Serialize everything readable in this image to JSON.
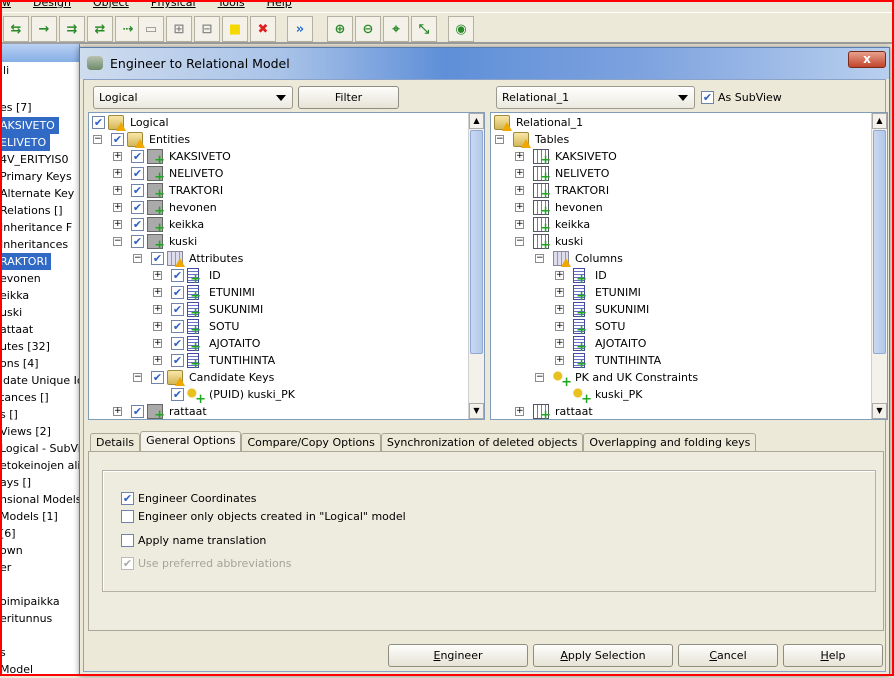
{
  "menubar": [
    "w",
    "Design",
    "Object",
    "Physical",
    "Tools",
    "Help"
  ],
  "toolbar": {
    "icons": [
      "relation-1n-icon",
      "relation-11-icon",
      "relation-1n-identifying-icon",
      "relation-nn-icon",
      "arrow-dotted-icon",
      "table-gray-icon",
      "table-add-gray-icon",
      "table-remove-gray-icon",
      "note-icon",
      "delete-icon",
      "engineer-icon",
      "zoom-in-icon",
      "zoom-out-icon",
      "fit-screen-icon",
      "resize-icon",
      "find-icon"
    ]
  },
  "left_panel": {
    "items": [
      {
        "label": "lli",
        "sel": false
      },
      {
        "label": "es [7]",
        "sel": false
      },
      {
        "label": "AKSIVETO",
        "sel": true
      },
      {
        "label": "ELIVETO",
        "sel": true
      },
      {
        "label": "4V_ERITYIS0",
        "sel": false
      },
      {
        "label": "Primary Keys",
        "sel": false
      },
      {
        "label": "Alternate Key",
        "sel": false
      },
      {
        "label": "Relations []",
        "sel": false
      },
      {
        "label": "Inheritance F",
        "sel": false
      },
      {
        "label": "Inheritances",
        "sel": false
      },
      {
        "label": "RAKTORI",
        "sel": true
      },
      {
        "label": "evonen",
        "sel": false
      },
      {
        "label": "eikka",
        "sel": false
      },
      {
        "label": "uski",
        "sel": false
      },
      {
        "label": "attaat",
        "sel": false
      },
      {
        "label": "utes [32]",
        "sel": false
      },
      {
        "label": "ons [4]",
        "sel": false
      },
      {
        "label": "idate Unique Ide",
        "sel": false
      },
      {
        "label": "tances []",
        "sel": false
      },
      {
        "label": "s []",
        "sel": false
      },
      {
        "label": "Views [2]",
        "sel": false
      },
      {
        "label": "Logical - SubVie",
        "sel": false
      },
      {
        "label": "etokeinojen alika",
        "sel": false
      },
      {
        "label": "ays []",
        "sel": false
      },
      {
        "label": "nsional Models [",
        "sel": false
      },
      {
        "label": " Models [1]",
        "sel": false
      },
      {
        "label": "[6]",
        "sel": false
      },
      {
        "label": "own",
        "sel": false
      },
      {
        "label": "er",
        "sel": false
      },
      {
        "label": "",
        "sel": false
      },
      {
        "label": "oimipaikka",
        "sel": false
      },
      {
        "label": "eritunnus",
        "sel": false
      },
      {
        "label": "",
        "sel": false
      },
      {
        "label": "s",
        "sel": false
      },
      {
        "label": "Model",
        "sel": false
      }
    ]
  },
  "dialog": {
    "title": "Engineer to Relational Model",
    "close": "x",
    "left": {
      "combo": "Logical",
      "filter": "Filter",
      "tree": [
        {
          "label": "Logical",
          "level": 0,
          "exp": "",
          "checked": true,
          "icon": "folder"
        },
        {
          "label": "Entities",
          "level": 1,
          "exp": "-",
          "checked": true,
          "icon": "folder"
        },
        {
          "label": "KAKSIVETO",
          "level": 2,
          "exp": "+",
          "checked": true,
          "icon": "entity"
        },
        {
          "label": "NELIVETO",
          "level": 2,
          "exp": "+",
          "checked": true,
          "icon": "entity"
        },
        {
          "label": "TRAKTORI",
          "level": 2,
          "exp": "+",
          "checked": true,
          "icon": "entity"
        },
        {
          "label": "hevonen",
          "level": 2,
          "exp": "+",
          "checked": true,
          "icon": "entity"
        },
        {
          "label": "keikka",
          "level": 2,
          "exp": "+",
          "checked": true,
          "icon": "entity"
        },
        {
          "label": "kuski",
          "level": 2,
          "exp": "-",
          "checked": true,
          "icon": "entity"
        },
        {
          "label": "Attributes",
          "level": 3,
          "exp": "-",
          "checked": true,
          "icon": "cols"
        },
        {
          "label": "ID",
          "level": 4,
          "exp": "+",
          "checked": true,
          "icon": "attr"
        },
        {
          "label": "ETUNIMI",
          "level": 4,
          "exp": "+",
          "checked": true,
          "icon": "attr"
        },
        {
          "label": "SUKUNIMI",
          "level": 4,
          "exp": "+",
          "checked": true,
          "icon": "attr"
        },
        {
          "label": "SOTU",
          "level": 4,
          "exp": "+",
          "checked": true,
          "icon": "attr"
        },
        {
          "label": "AJOTAITO",
          "level": 4,
          "exp": "+",
          "checked": true,
          "icon": "attr"
        },
        {
          "label": "TUNTIHINTA",
          "level": 4,
          "exp": "+",
          "checked": true,
          "icon": "attr"
        },
        {
          "label": "Candidate Keys",
          "level": 3,
          "exp": "-",
          "checked": true,
          "icon": "folder"
        },
        {
          "label": "(PUID) kuski_PK",
          "level": 4,
          "exp": "",
          "checked": true,
          "icon": "key"
        },
        {
          "label": "rattaat",
          "level": 2,
          "exp": "+",
          "checked": true,
          "icon": "entity"
        }
      ]
    },
    "right": {
      "combo": "Relational_1",
      "as_subview": {
        "label": "As SubView",
        "checked": true
      },
      "tree": [
        {
          "label": "Relational_1",
          "level": 0,
          "exp": "",
          "icon": "folder"
        },
        {
          "label": "Tables",
          "level": 1,
          "exp": "-",
          "icon": "folder"
        },
        {
          "label": "KAKSIVETO",
          "level": 2,
          "exp": "+",
          "icon": "table"
        },
        {
          "label": "NELIVETO",
          "level": 2,
          "exp": "+",
          "icon": "table"
        },
        {
          "label": "TRAKTORI",
          "level": 2,
          "exp": "+",
          "icon": "table"
        },
        {
          "label": "hevonen",
          "level": 2,
          "exp": "+",
          "icon": "table"
        },
        {
          "label": "keikka",
          "level": 2,
          "exp": "+",
          "icon": "table"
        },
        {
          "label": "kuski",
          "level": 2,
          "exp": "-",
          "icon": "table"
        },
        {
          "label": "Columns",
          "level": 3,
          "exp": "-",
          "icon": "cols"
        },
        {
          "label": "ID",
          "level": 4,
          "exp": "+",
          "icon": "attr"
        },
        {
          "label": "ETUNIMI",
          "level": 4,
          "exp": "+",
          "icon": "attr"
        },
        {
          "label": "SUKUNIMI",
          "level": 4,
          "exp": "+",
          "icon": "attr"
        },
        {
          "label": "SOTU",
          "level": 4,
          "exp": "+",
          "icon": "attr"
        },
        {
          "label": "AJOTAITO",
          "level": 4,
          "exp": "+",
          "icon": "attr"
        },
        {
          "label": "TUNTIHINTA",
          "level": 4,
          "exp": "+",
          "icon": "attr"
        },
        {
          "label": "PK and UK Constraints",
          "level": 3,
          "exp": "-",
          "icon": "key"
        },
        {
          "label": "kuski_PK",
          "level": 4,
          "exp": "",
          "icon": "key"
        },
        {
          "label": "rattaat",
          "level": 2,
          "exp": "+",
          "icon": "table"
        }
      ]
    },
    "tabs": [
      {
        "label": "Details",
        "active": false
      },
      {
        "label": "General Options",
        "active": true
      },
      {
        "label": "Compare/Copy Options",
        "active": false
      },
      {
        "label": "Synchronization of deleted objects",
        "active": false
      },
      {
        "label": "Overlapping and folding keys",
        "active": false
      }
    ],
    "options": [
      {
        "label": "Engineer Coordinates",
        "checked": true,
        "disabled": false
      },
      {
        "label": "Engineer only objects created in \"Logical\" model",
        "checked": false,
        "disabled": false
      },
      {
        "label": "Apply name translation",
        "checked": false,
        "disabled": false
      },
      {
        "label": "Use preferred abbreviations",
        "checked": true,
        "disabled": true
      }
    ],
    "buttons": {
      "engineer_mn": "E",
      "engineer": "ngineer",
      "apply_mn": "A",
      "apply": "pply Selection",
      "cancel_mn": "C",
      "cancel": "ancel",
      "help_mn": "H",
      "help": "elp"
    }
  }
}
